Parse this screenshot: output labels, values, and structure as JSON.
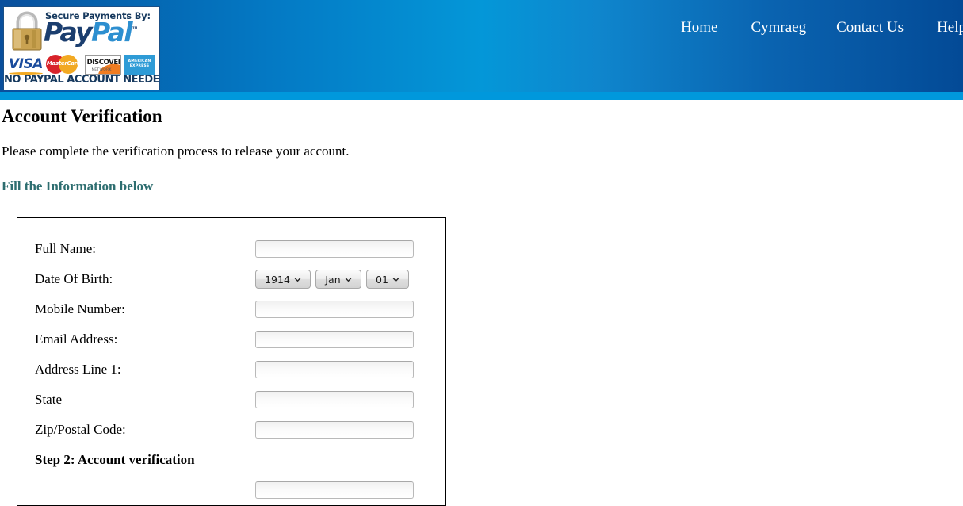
{
  "header": {
    "badge": {
      "top_text": "Secure Payments By:",
      "brand_first": "Pay",
      "brand_second": "Pal",
      "trademark": "™",
      "bottom_text": "NO PAYPAL ACCOUNT NEEDED!",
      "lock_icon": "padlock-icon",
      "cards": [
        {
          "name": "visa",
          "label": "VISA"
        },
        {
          "name": "mastercard",
          "label": "MasterCard"
        },
        {
          "name": "discover",
          "label": "DISCOVER",
          "sub_label": "NETWORK"
        },
        {
          "name": "amex",
          "label": "AMERICAN EXPRESS"
        }
      ]
    },
    "nav": [
      {
        "label": "Home"
      },
      {
        "label": "Cymraeg"
      },
      {
        "label": "Contact Us"
      },
      {
        "label": "Help"
      }
    ],
    "colors": {
      "gradient_dark": "#0a4f9c",
      "gradient_light": "#0497d8",
      "underbar": "#0098dc",
      "nav_text": "#ffffff"
    }
  },
  "main": {
    "title": "Account Verification",
    "subtitle": "Please complete the verification process to release your account.",
    "section_heading": "Fill the Information below",
    "section_heading_color": "#2e6e70",
    "form": {
      "fields": [
        {
          "label": "Full Name:",
          "type": "text",
          "value": "",
          "placeholder": ""
        },
        {
          "label": "Date Of Birth:",
          "type": "date-select"
        },
        {
          "label": "Mobile Number:",
          "type": "text",
          "value": "",
          "placeholder": ""
        },
        {
          "label": "Email Address:",
          "type": "text",
          "value": "",
          "placeholder": ""
        },
        {
          "label": "Address Line 1:",
          "type": "text",
          "value": "",
          "placeholder": ""
        },
        {
          "label": "State",
          "type": "text",
          "value": "",
          "placeholder": ""
        },
        {
          "label": "Zip/Postal Code:",
          "type": "text",
          "value": "",
          "placeholder": ""
        }
      ],
      "dob": {
        "year": {
          "selected": "1914"
        },
        "month": {
          "selected": "Jan"
        },
        "day": {
          "selected": "01"
        },
        "chevron_icon": "chevron-down-icon"
      },
      "step2_heading": "Step 2: Account verification",
      "step2_heading_color": "#008000",
      "partial_row": {
        "label": "",
        "value": "",
        "placeholder": ""
      }
    }
  }
}
